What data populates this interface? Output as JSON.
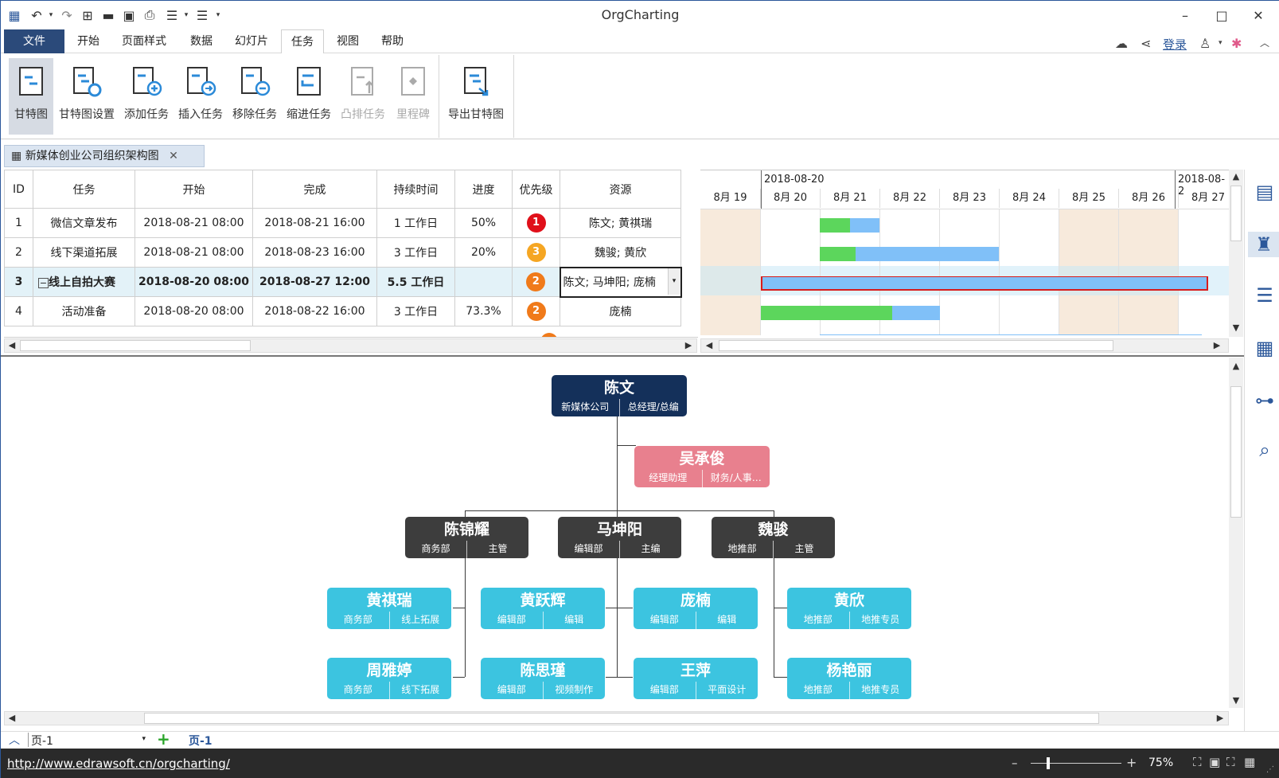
{
  "app": {
    "title": "OrgCharting"
  },
  "menu": {
    "items": [
      "文件",
      "开始",
      "页面样式",
      "数据",
      "幻灯片",
      "任务",
      "视图",
      "帮助"
    ],
    "login": "登录"
  },
  "ribbon": {
    "buttons": [
      "甘特图",
      "甘特图设置",
      "添加任务",
      "插入任务",
      "移除任务",
      "缩进任务",
      "凸排任务",
      "里程碑",
      "导出甘特图"
    ]
  },
  "doc_tab": {
    "title": "新媒体创业公司组织架构图"
  },
  "grid": {
    "headers": [
      "ID",
      "任务",
      "开始",
      "完成",
      "持续时间",
      "进度",
      "优先级",
      "资源"
    ],
    "rows": [
      {
        "id": "1",
        "task": "微信文章发布",
        "start": "2018-08-21 08:00",
        "end": "2018-08-21 16:00",
        "dur": "1 工作日",
        "progress": "50%",
        "priority": "1",
        "res": "陈文; 黄祺瑞"
      },
      {
        "id": "2",
        "task": "线下渠道拓展",
        "start": "2018-08-21 08:00",
        "end": "2018-08-23 16:00",
        "dur": "3 工作日",
        "progress": "20%",
        "priority": "3",
        "res": "魏骏; 黄欣"
      },
      {
        "id": "3",
        "task": "线上自拍大赛",
        "start": "2018-08-20 08:00",
        "end": "2018-08-27 12:00",
        "dur": "5.5 工作日",
        "progress": "",
        "priority": "2",
        "res": "陈文; 马坤阳; 庞楠"
      },
      {
        "id": "4",
        "task": "活动准备",
        "start": "2018-08-20 08:00",
        "end": "2018-08-22 16:00",
        "dur": "3 工作日",
        "progress": "73.3%",
        "priority": "2",
        "res": "庞楠"
      }
    ]
  },
  "gantt": {
    "week_labels": [
      "2018-08-20",
      "2018-08-2"
    ],
    "days": [
      "8月 19",
      "8月 20",
      "8月 21",
      "8月 22",
      "8月 23",
      "8月 24",
      "8月 25",
      "8月 26",
      "8月 27"
    ]
  },
  "org": {
    "ceo": {
      "name": "陈文",
      "dept": "新媒体公司",
      "title": "总经理/总编"
    },
    "assistant": {
      "name": "吴承俊",
      "dept": "经理助理",
      "title": "财务/人事…"
    },
    "managers": [
      {
        "name": "陈锦耀",
        "dept": "商务部",
        "title": "主管"
      },
      {
        "name": "马坤阳",
        "dept": "编辑部",
        "title": "主编"
      },
      {
        "name": "魏骏",
        "dept": "地推部",
        "title": "主管"
      }
    ],
    "staff_row1": [
      {
        "name": "黄祺瑞",
        "dept": "商务部",
        "title": "线上拓展"
      },
      {
        "name": "黄跃辉",
        "dept": "编辑部",
        "title": "编辑"
      },
      {
        "name": "庞楠",
        "dept": "编辑部",
        "title": "编辑"
      },
      {
        "name": "黄欣",
        "dept": "地推部",
        "title": "地推专员"
      }
    ],
    "staff_row2": [
      {
        "name": "周雅婷",
        "dept": "商务部",
        "title": "线下拓展"
      },
      {
        "name": "陈思瑾",
        "dept": "编辑部",
        "title": "视频制作"
      },
      {
        "name": "王萍",
        "dept": "编辑部",
        "title": "平面设计"
      },
      {
        "name": "杨艳丽",
        "dept": "地推部",
        "title": "地推专员"
      }
    ]
  },
  "pages": {
    "selector": "页-1",
    "current": "页-1"
  },
  "status": {
    "url": "http://www.edrawsoft.cn/orgcharting/",
    "zoom": "75%"
  },
  "colors": {
    "ceo": "#14305a",
    "assistant": "#e8808e",
    "manager": "#3d3d3d",
    "staff": "#3cc4e0",
    "progress": "#5cd65c",
    "remaining": "#80c0f8"
  }
}
